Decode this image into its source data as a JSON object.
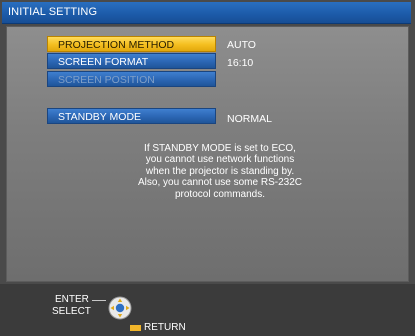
{
  "title_bar": {
    "title": "INITIAL SETTING"
  },
  "menu": {
    "items": [
      {
        "label": "PROJECTION METHOD",
        "value": "AUTO",
        "state": "selected"
      },
      {
        "label": "SCREEN FORMAT",
        "value": "16:10",
        "state": "normal"
      },
      {
        "label": "SCREEN POSITION",
        "value": "",
        "state": "disabled"
      },
      {
        "label": "STANDBY MODE",
        "value": "NORMAL",
        "state": "normal"
      }
    ]
  },
  "message": {
    "lines": [
      "If STANDBY MODE is set to ECO,",
      "you cannot use network functions",
      "when the projector is standing by.",
      "Also, you cannot use some RS-232C",
      "protocol commands."
    ]
  },
  "footer": {
    "enter_label": "ENTER",
    "select_label": "SELECT",
    "return_label": "RETURN"
  },
  "icons": {
    "control_pad": "directional-pad-icon",
    "return_bar": "return-key-icon"
  },
  "colors": {
    "title_blue": "#1c5aa8",
    "selected_yellow": "#f4be1f",
    "item_blue": "#2b66b4",
    "panel_gray": "#7e7e7e",
    "footer_gray": "#3b3b3b"
  }
}
